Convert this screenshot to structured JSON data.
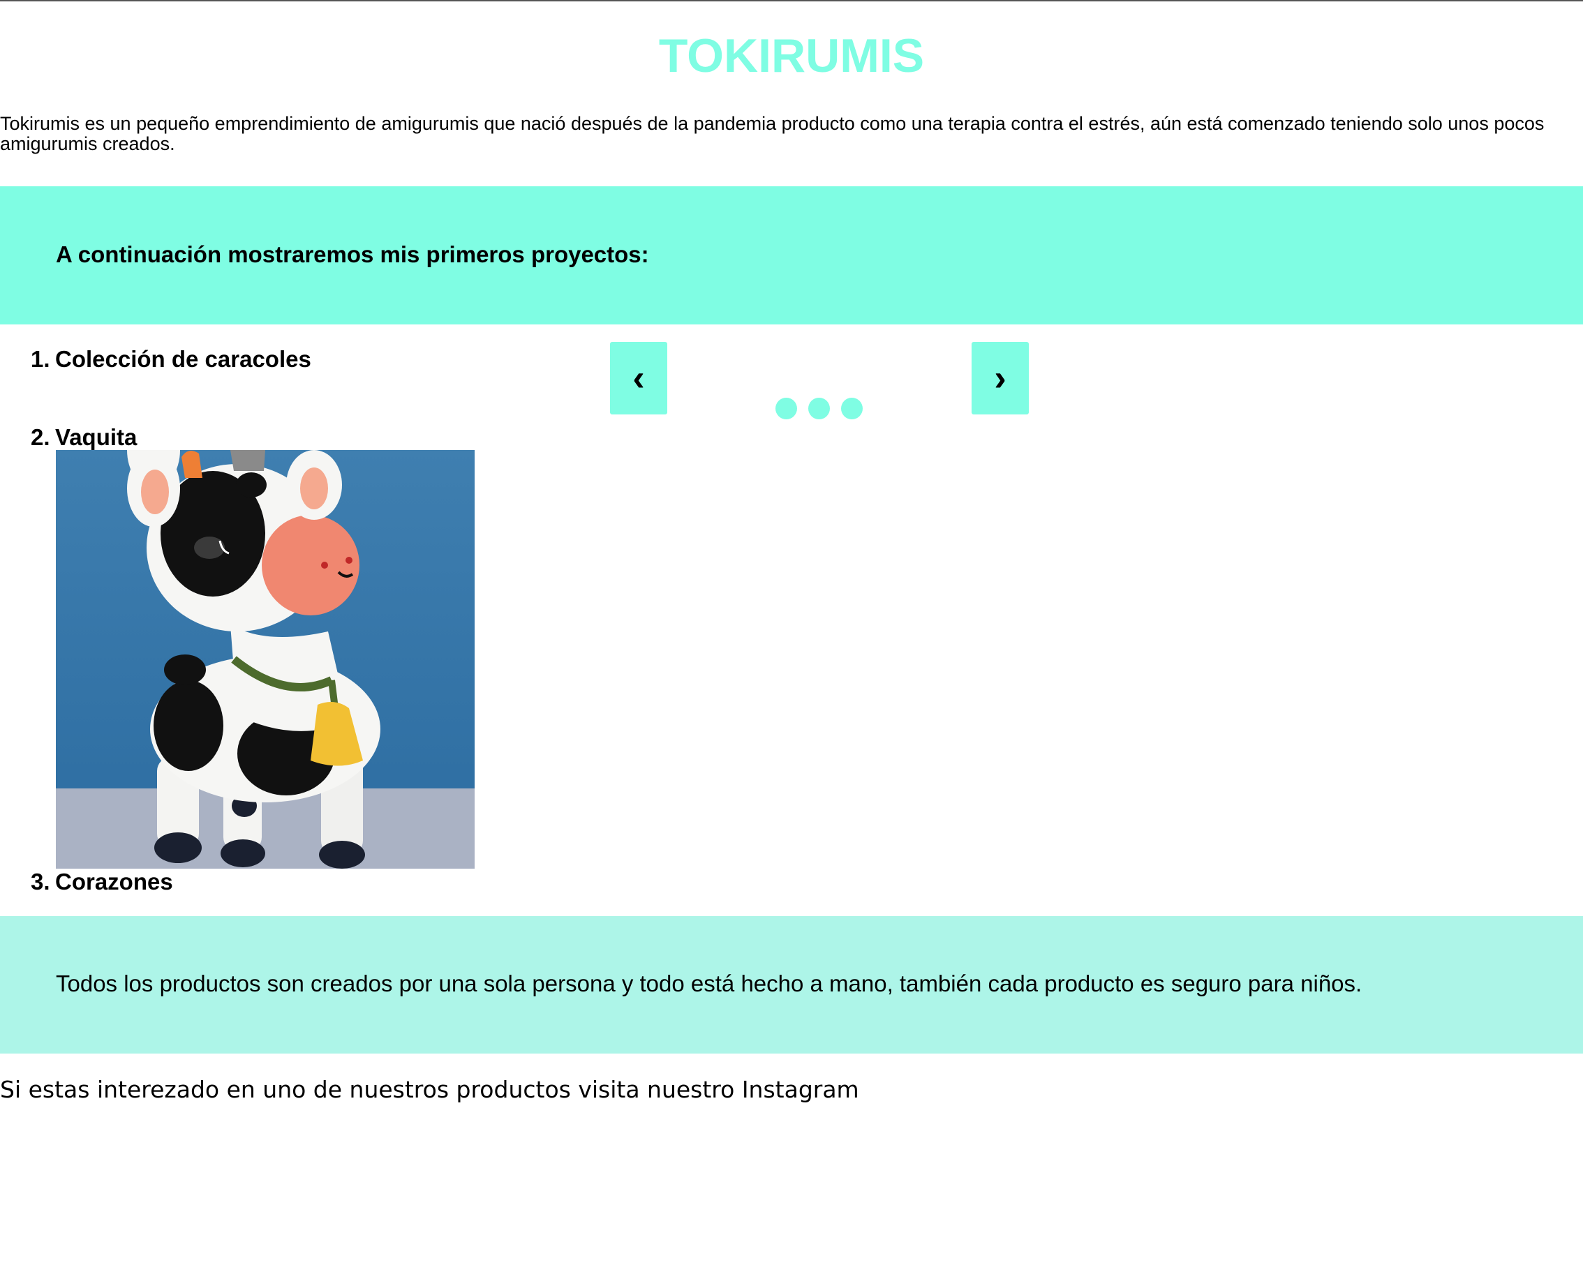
{
  "header": {
    "title": "TOKIRUMIS"
  },
  "intro": {
    "text": "Tokirumis es un pequeño emprendimiento de amigurumis que nació después de la pandemia producto como una terapia contra el estrés, aún está comenzado teniendo solo unos pocos amigurumis creados."
  },
  "projects_banner": {
    "heading": "A continuación mostraremos mis primeros proyectos:"
  },
  "projects": [
    {
      "number": "1.",
      "name": "Colección de caracoles"
    },
    {
      "number": "2.",
      "name": "Vaquita"
    },
    {
      "number": "3.",
      "name": "Corazones"
    }
  ],
  "carousel": {
    "prev_label": "‹",
    "next_label": "›",
    "dot_count": 3
  },
  "info_banner": {
    "text": "Todos los productos son creados por una sola persona y todo está hecho a mano, también cada producto es seguro para niños."
  },
  "footer": {
    "text": "Si estas interezado en uno de nuestros productos visita nuestro Instagram"
  },
  "colors": {
    "accent": "#7ffde3",
    "accent_light": "#adf5e8"
  },
  "photo": {
    "icon": "amigurumi-cow-photo"
  }
}
